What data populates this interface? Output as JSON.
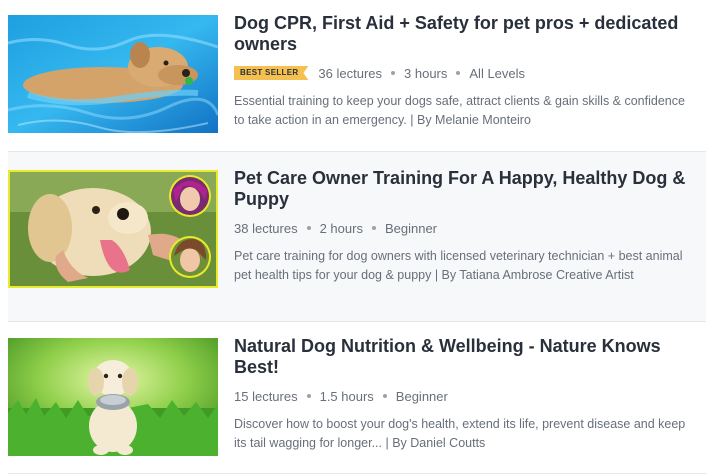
{
  "courses": [
    {
      "title": "Dog CPR, First Aid + Safety for pet pros + dedicated owners",
      "badge": "BEST SELLER",
      "lectures": "36 lectures",
      "duration": "3 hours",
      "level": "All Levels",
      "description": "Essential training to keep your dogs safe, attract clients & gain skills & confidence to take action in an emergency. | By Melanie Monteiro",
      "thumbnail": "dog-swimming-image"
    },
    {
      "title": "Pet Care Owner Training For A Happy, Healthy Dog & Puppy",
      "badge": "",
      "lectures": "38 lectures",
      "duration": "2 hours",
      "level": "Beginner",
      "description": "Pet care training for dog owners with licensed veterinary technician + best animal pet health tips for your dog & puppy | By Tatiana Ambrose Creative Artist",
      "thumbnail": "golden-retriever-with-instructors-image"
    },
    {
      "title": "Natural Dog Nutrition & Wellbeing - Nature Knows Best!",
      "badge": "",
      "lectures": "15 lectures",
      "duration": "1.5 hours",
      "level": "Beginner",
      "description": "Discover how to boost your dog's health, extend its life, prevent disease and keep its tail wagging for longer... | By Daniel Coutts",
      "thumbnail": "puppy-with-bowl-image"
    }
  ],
  "colors": {
    "badge": "#f4c150",
    "title": "#29303b",
    "muted": "#686f7a",
    "highlight_row": "#f7f8fa"
  }
}
